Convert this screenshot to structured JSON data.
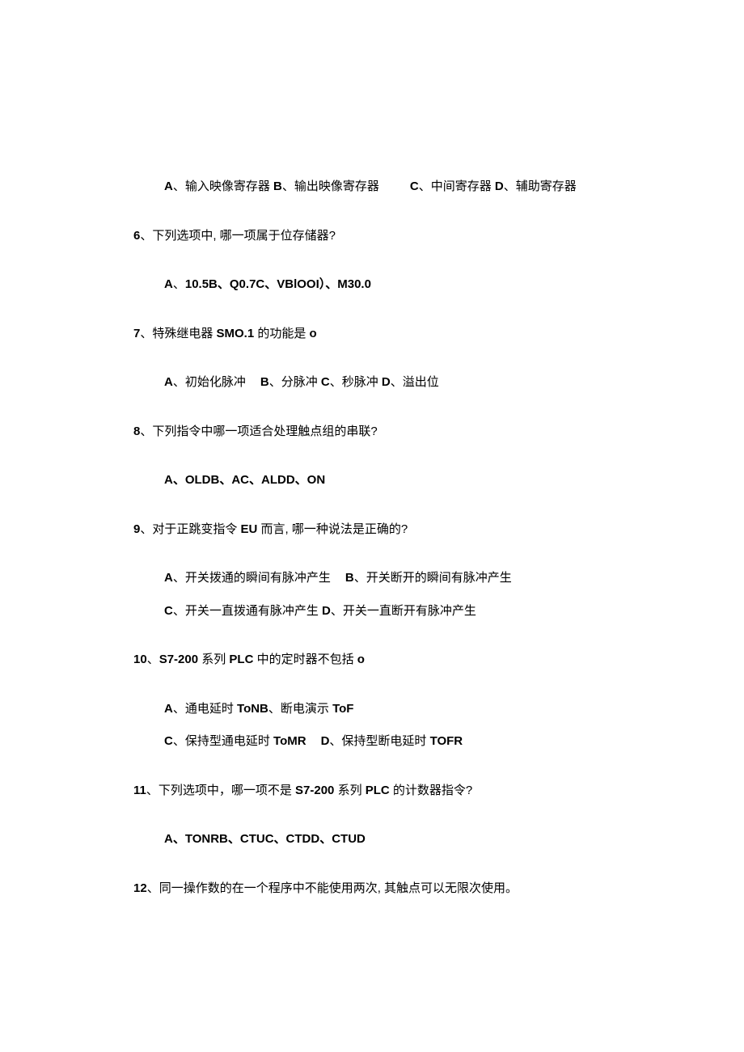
{
  "q5_options": {
    "a_label": "A",
    "a_text": "、输入映像寄存器 ",
    "b_label": "B",
    "b_text": "、输出映像寄存器",
    "c_label": "C",
    "c_text": "、中间寄存器 ",
    "d_label": "D",
    "d_text": "、辅助寄存器"
  },
  "q6": {
    "num": "6",
    "text": "、下列选项中, 哪一项属于位存储器?",
    "opts": {
      "a_label": "A",
      "a_text": "、",
      "opt_text": "10.5B、Q0.7C、VBlOOI）、M30.0"
    }
  },
  "q7": {
    "num": "7",
    "text1": "、特殊继电器 ",
    "bold1": "SMO.1 ",
    "text2": "的功能是 ",
    "bold2": "o",
    "opts": {
      "a_label": "A",
      "a_text": "、初始化脉冲",
      "b_label": "B",
      "b_text": "、分脉冲 ",
      "c_label": "C",
      "c_text": "、秒脉冲 ",
      "d_label": "D",
      "d_text": "、溢出位"
    }
  },
  "q8": {
    "num": "8",
    "text": "、下列指令中哪一项适合处理触点组的串联?",
    "opts": {
      "line": "A、OLDB、AC、ALDD、ON"
    }
  },
  "q9": {
    "num": "9",
    "text1": "、对于正跳变指令 ",
    "bold1": "EU ",
    "text2": "而言, 哪一种说法是正确的?",
    "opts": {
      "a_label": "A",
      "a_text": "、开关拨通的瞬间有脉冲产生",
      "b_label": "B",
      "b_text": "、开关断开的瞬间有脉冲产生",
      "c_label": "C",
      "c_text": "、开关一直拨通有脉冲产生 ",
      "d_label": "D",
      "d_text": "、开关一直断开有脉冲产生"
    }
  },
  "q10": {
    "num": "10",
    "text1": "、",
    "bold1": "S7-200 ",
    "text2": "系列 ",
    "bold2": "PLC ",
    "text3": "中的定时器不包括 ",
    "bold3": "o",
    "opts": {
      "a_label": "A",
      "a_text": "、通电延时 ",
      "a_bold": "ToNB",
      "a_text2": "、断电演示 ",
      "a_bold2": "ToF",
      "c_label": "C",
      "c_text": "、保持型通电延时 ",
      "c_bold": "ToMR",
      "d_label": "D",
      "d_text": "、保持型断电延时 ",
      "d_bold": "TOFR"
    }
  },
  "q11": {
    "num": "11",
    "text1": "、下列选项中，哪一项不是 ",
    "bold1": "S7-200 ",
    "text2": "系列 ",
    "bold2": "PLC ",
    "text3": "的计数器指令?",
    "opts": {
      "line": "A、TONRB、CTUC、CTDD、CTUD"
    }
  },
  "q12": {
    "num": "12",
    "text": "、同一操作数的在一个程序中不能使用两次, 其触点可以无限次使用。"
  }
}
